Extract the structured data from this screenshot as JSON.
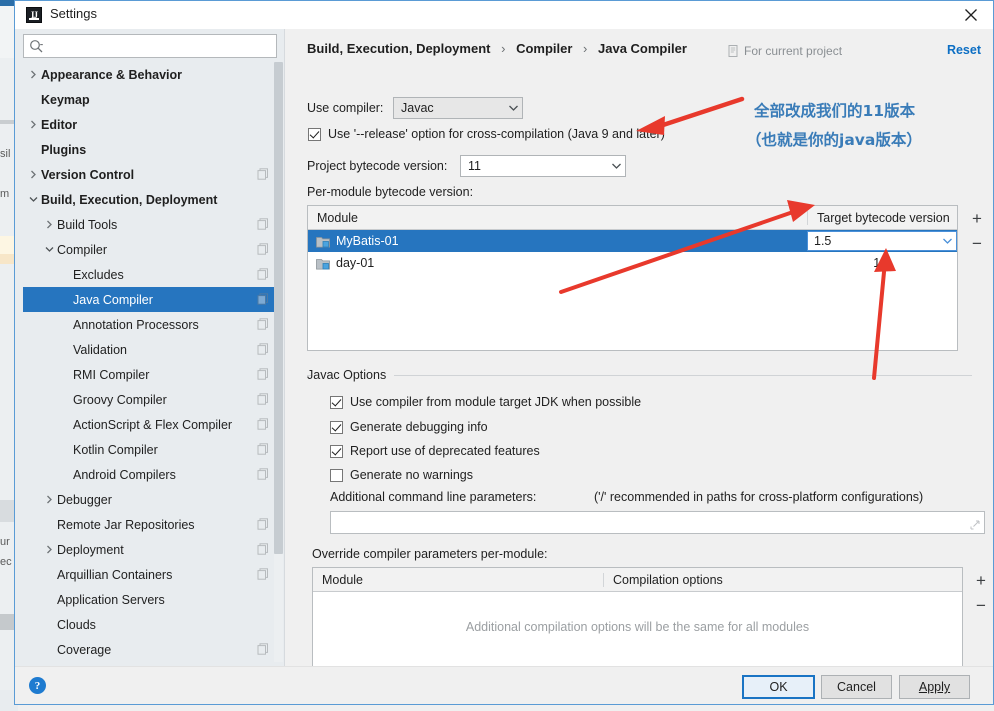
{
  "window": {
    "title": "Settings",
    "icon": "intellij-idea-icon",
    "close_icon": "close-icon"
  },
  "sidebar": {
    "search": {
      "placeholder": "",
      "value": "",
      "icon": "search-icon"
    },
    "items": [
      {
        "label": "Appearance & Behavior",
        "indent": 0,
        "arrow": "right",
        "bold": true,
        "badge": false,
        "selected": false
      },
      {
        "label": "Keymap",
        "indent": 0,
        "arrow": "none",
        "bold": true,
        "badge": false,
        "selected": false
      },
      {
        "label": "Editor",
        "indent": 0,
        "arrow": "right",
        "bold": true,
        "badge": false,
        "selected": false
      },
      {
        "label": "Plugins",
        "indent": 0,
        "arrow": "none",
        "bold": true,
        "badge": false,
        "selected": false
      },
      {
        "label": "Version Control",
        "indent": 0,
        "arrow": "right",
        "bold": true,
        "badge": true,
        "selected": false
      },
      {
        "label": "Build, Execution, Deployment",
        "indent": 0,
        "arrow": "down",
        "bold": true,
        "badge": false,
        "selected": false
      },
      {
        "label": "Build Tools",
        "indent": 1,
        "arrow": "right",
        "bold": false,
        "badge": true,
        "selected": false
      },
      {
        "label": "Compiler",
        "indent": 1,
        "arrow": "down",
        "bold": false,
        "badge": true,
        "selected": false
      },
      {
        "label": "Excludes",
        "indent": 2,
        "arrow": "none",
        "bold": false,
        "badge": true,
        "selected": false
      },
      {
        "label": "Java Compiler",
        "indent": 2,
        "arrow": "none",
        "bold": false,
        "badge": true,
        "selected": true
      },
      {
        "label": "Annotation Processors",
        "indent": 2,
        "arrow": "none",
        "bold": false,
        "badge": true,
        "selected": false
      },
      {
        "label": "Validation",
        "indent": 2,
        "arrow": "none",
        "bold": false,
        "badge": true,
        "selected": false
      },
      {
        "label": "RMI Compiler",
        "indent": 2,
        "arrow": "none",
        "bold": false,
        "badge": true,
        "selected": false
      },
      {
        "label": "Groovy Compiler",
        "indent": 2,
        "arrow": "none",
        "bold": false,
        "badge": true,
        "selected": false
      },
      {
        "label": "ActionScript & Flex Compiler",
        "indent": 2,
        "arrow": "none",
        "bold": false,
        "badge": true,
        "selected": false
      },
      {
        "label": "Kotlin Compiler",
        "indent": 2,
        "arrow": "none",
        "bold": false,
        "badge": true,
        "selected": false
      },
      {
        "label": "Android Compilers",
        "indent": 2,
        "arrow": "none",
        "bold": false,
        "badge": true,
        "selected": false
      },
      {
        "label": "Debugger",
        "indent": 1,
        "arrow": "right",
        "bold": false,
        "badge": false,
        "selected": false
      },
      {
        "label": "Remote Jar Repositories",
        "indent": 1,
        "arrow": "none",
        "bold": false,
        "badge": true,
        "selected": false
      },
      {
        "label": "Deployment",
        "indent": 1,
        "arrow": "right",
        "bold": false,
        "badge": true,
        "selected": false
      },
      {
        "label": "Arquillian Containers",
        "indent": 1,
        "arrow": "none",
        "bold": false,
        "badge": true,
        "selected": false
      },
      {
        "label": "Application Servers",
        "indent": 1,
        "arrow": "none",
        "bold": false,
        "badge": false,
        "selected": false
      },
      {
        "label": "Clouds",
        "indent": 1,
        "arrow": "none",
        "bold": false,
        "badge": false,
        "selected": false
      },
      {
        "label": "Coverage",
        "indent": 1,
        "arrow": "none",
        "bold": false,
        "badge": true,
        "selected": false
      }
    ]
  },
  "main": {
    "breadcrumb": [
      "Build, Execution, Deployment",
      "Compiler",
      "Java Compiler"
    ],
    "breadcrumb_separator": "›",
    "scope_label": "For current project",
    "scope_icon": "document-icon",
    "reset_label": "Reset",
    "use_compiler_label": "Use compiler:",
    "use_compiler_value": "Javac",
    "release_option_label": "Use '--release' option for cross-compilation (Java 9 and later)",
    "release_option_checked": true,
    "project_bytecode_label": "Project bytecode version:",
    "project_bytecode_value": "11",
    "per_module_label": "Per-module bytecode version:",
    "module_table": {
      "columns": [
        "Module",
        "Target bytecode version"
      ],
      "rows": [
        {
          "module": "MyBatis-01",
          "version": "1.5",
          "selected": true,
          "editing": true
        },
        {
          "module": "day-01",
          "version": "1.5",
          "selected": false,
          "editing": false
        }
      ],
      "add_label": "+",
      "remove_label": "−"
    },
    "javac_options": {
      "title": "Javac Options",
      "checkboxes": [
        {
          "label": "Use compiler from module target JDK when possible",
          "checked": true
        },
        {
          "label": "Generate debugging info",
          "checked": true
        },
        {
          "label": "Report use of deprecated features",
          "checked": true
        },
        {
          "label": "Generate no warnings",
          "checked": false
        }
      ],
      "additional_params_label": "Additional command line parameters:",
      "additional_params_hint": "('/' recommended in paths for cross-platform configurations)",
      "additional_params_value": ""
    },
    "override_section": {
      "label": "Override compiler parameters per-module:",
      "columns": [
        "Module",
        "Compilation options"
      ],
      "empty_text": "Additional compilation options will be the same for all modules",
      "add_label": "+",
      "remove_label": "−"
    }
  },
  "footer": {
    "help_label": "?",
    "ok_label": "OK",
    "cancel_label": "Cancel",
    "apply_label": "Apply"
  },
  "annotations": {
    "color": "#e8392c",
    "text_color": "#3a7cb8",
    "line1": "全部改成我们的11版本",
    "line2": "（也就是你的java版本）"
  }
}
